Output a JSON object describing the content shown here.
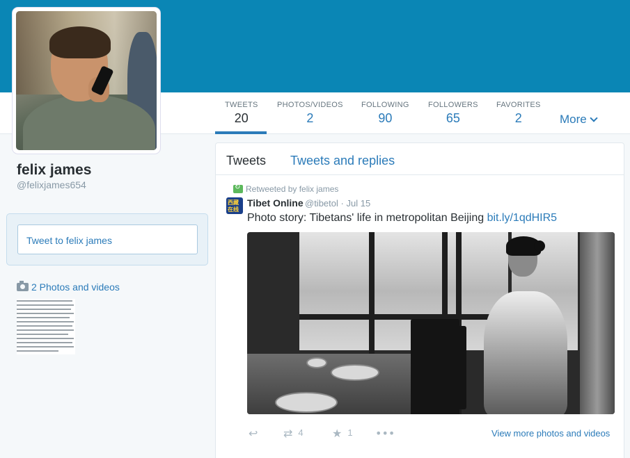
{
  "profile": {
    "name": "felix james",
    "handle": "@felixjames654"
  },
  "nav": {
    "items": [
      {
        "label": "TWEETS",
        "value": "20"
      },
      {
        "label": "PHOTOS/VIDEOS",
        "value": "2"
      },
      {
        "label": "FOLLOWING",
        "value": "90"
      },
      {
        "label": "FOLLOWERS",
        "value": "65"
      },
      {
        "label": "FAVORITES",
        "value": "2"
      }
    ],
    "more_label": "More"
  },
  "sidebar": {
    "tweet_to_placeholder": "Tweet to felix james",
    "photos_link": "2 Photos and videos"
  },
  "timeline": {
    "tabs": [
      "Tweets",
      "Tweets and replies"
    ]
  },
  "tweet": {
    "retweeted_by": "Retweeted by felix james",
    "author_name": "Tibet Online",
    "author_handle": "@tibetol",
    "separator": "·",
    "date": "Jul 15",
    "text": "Photo story: Tibetans' life in metropolitan Beijing",
    "link": "bit.ly/1qdHIR5",
    "avatar_text_top": "西藏",
    "avatar_text_bottom": "在线",
    "retweet_count": "4",
    "favorite_count": "1",
    "view_more": "View more photos and videos"
  },
  "colors": {
    "header": "#0a86b5",
    "accent": "#2b7bb9",
    "retweet_green": "#5cb85c"
  }
}
